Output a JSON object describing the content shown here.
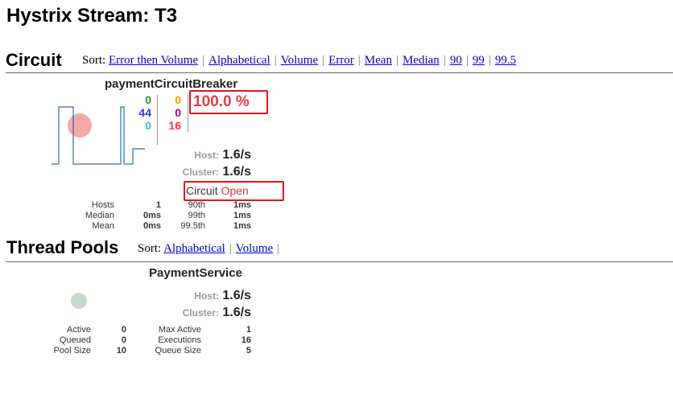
{
  "page": {
    "title": "Hystrix Stream: T3"
  },
  "circuit_section": {
    "title": "Circuit",
    "sort_prefix": "Sort:",
    "sort_links": [
      "Error then Volume",
      "Alphabetical",
      "Volume",
      "Error",
      "Mean",
      "Median",
      "90",
      "99",
      "99.5"
    ],
    "monitor": {
      "name": "paymentCircuitBreaker",
      "counts_left": {
        "success": "0",
        "short_circuited": "44",
        "bad_request": "0"
      },
      "counts_right": {
        "timeout": "0",
        "rejected": "0",
        "failure": "16"
      },
      "error_rate": "100.0 %",
      "host_label": "Host:",
      "host_rate": "1.6/s",
      "cluster_label": "Cluster:",
      "cluster_rate": "1.6/s",
      "circuit_label": "Circuit",
      "circuit_state": "Open",
      "stats": {
        "hosts_label": "Hosts",
        "hosts_value": "1",
        "median_label": "Median",
        "median_value": "0ms",
        "mean_label": "Mean",
        "mean_value": "0ms",
        "p90_label": "90th",
        "p90_value": "1ms",
        "p99_label": "99th",
        "p99_value": "1ms",
        "p995_label": "99.5th",
        "p995_value": "1ms"
      },
      "colors": {
        "bubble": "#f6a7a7",
        "sparkline": "#2a6ebb",
        "highlight": "#e0141e"
      }
    }
  },
  "thread_pools_section": {
    "title": "Thread Pools",
    "sort_prefix": "Sort:",
    "sort_links": [
      "Alphabetical",
      "Volume"
    ],
    "pool": {
      "name": "PaymentService",
      "host_label": "Host:",
      "host_rate": "1.6/s",
      "cluster_label": "Cluster:",
      "cluster_rate": "1.6/s",
      "stats": {
        "active_label": "Active",
        "active_value": "0",
        "queued_label": "Queued",
        "queued_value": "0",
        "pool_size_label": "Pool Size",
        "pool_size_value": "10",
        "max_active_label": "Max Active",
        "max_active_value": "1",
        "executions_label": "Executions",
        "executions_value": "16",
        "queue_size_label": "Queue Size",
        "queue_size_value": "5"
      },
      "colors": {
        "bubble": "#c7dac7"
      }
    }
  }
}
